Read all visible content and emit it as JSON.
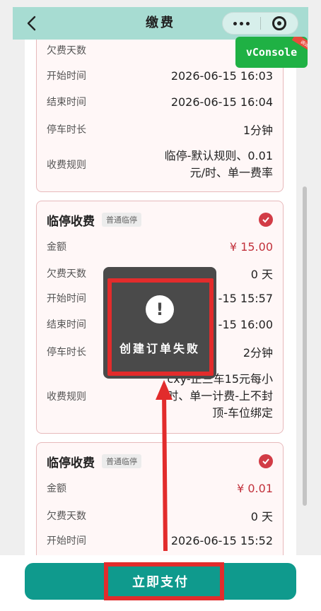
{
  "header": {
    "title": "缴费",
    "back_icon": "chevron-left-icon",
    "more_icon": "more-dots-icon",
    "close_icon": "target-close-icon"
  },
  "vconsole": {
    "label": "vConsole",
    "ribbon": "调试"
  },
  "cards": [
    {
      "rows": [
        {
          "label": "欠费天数",
          "value": ""
        },
        {
          "label": "开始时间",
          "value": "2026-06-15 16:03"
        },
        {
          "label": "结束时间",
          "value": "2026-06-15 16:04"
        },
        {
          "label": "停车时长",
          "value": "1分钟"
        },
        {
          "label": "收费规则",
          "value": "临停-默认规则、0.01元/时、单一费率"
        }
      ]
    },
    {
      "title": "临停收费",
      "tag": "普通临停",
      "rows": [
        {
          "label": "金额",
          "value": "¥ 15.00"
        },
        {
          "label": "欠费天数",
          "value": "0 天"
        },
        {
          "label": "开始时间",
          "value": "-15 15:57"
        },
        {
          "label": "结束时间",
          "value": "-15 16:00"
        },
        {
          "label": "停车时长",
          "value": "2分钟"
        },
        {
          "label": "收费规则",
          "value": "cxy-正三车15元每小时、单一计费-上不封顶-车位绑定"
        }
      ]
    },
    {
      "title": "临停收费",
      "tag": "普通临停",
      "rows": [
        {
          "label": "金额",
          "value": "¥ 0.01"
        },
        {
          "label": "欠费天数",
          "value": "0 天"
        },
        {
          "label": "开始时间",
          "value": "2026-06-15 15:52"
        }
      ]
    }
  ],
  "toast": {
    "icon_text": "!",
    "message": "创建订单失败"
  },
  "footer": {
    "pay_label": "立即支付"
  },
  "colors": {
    "accent": "#0f9a8d",
    "money": "#c2323c",
    "annotation": "#e22c2c"
  }
}
